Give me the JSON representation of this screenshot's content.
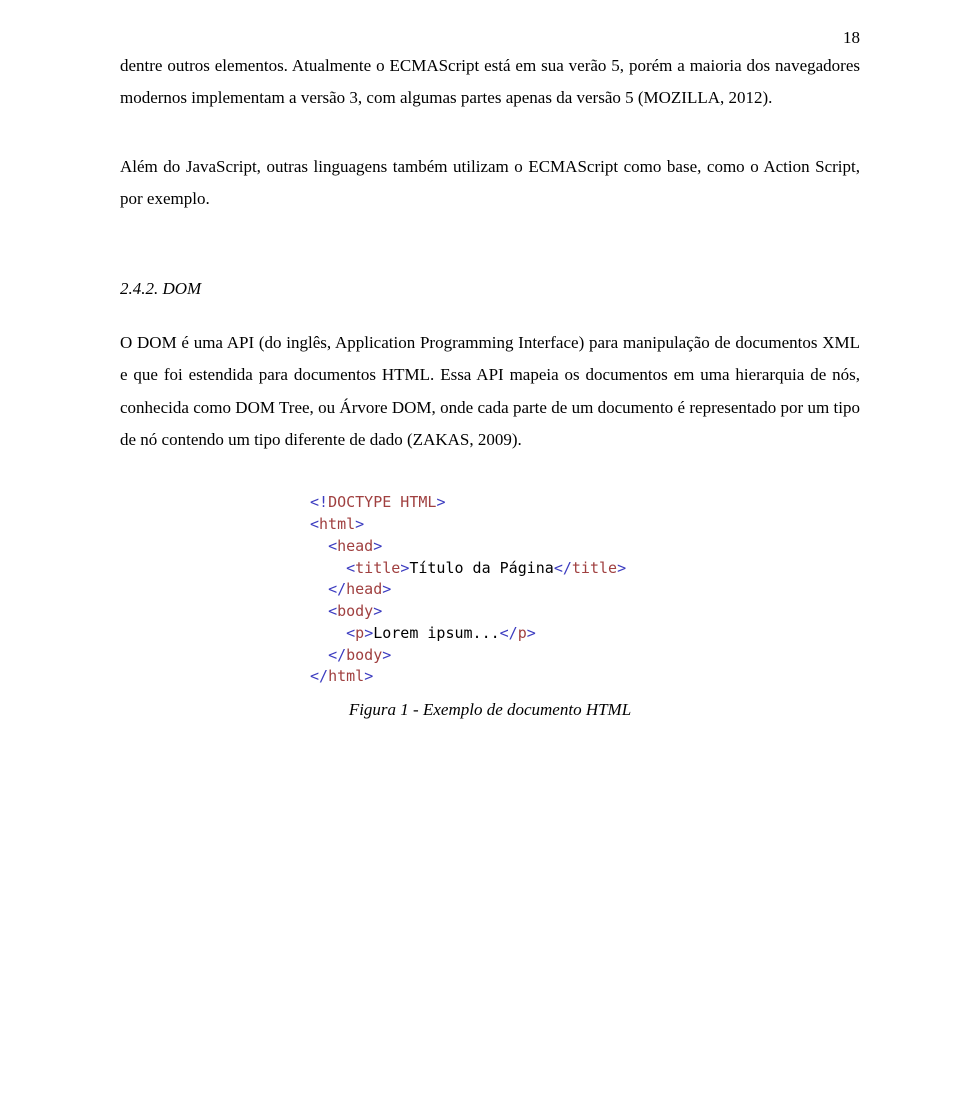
{
  "page_number": "18",
  "para1": "dentre outros elementos. Atualmente o ECMAScript está em sua verão 5, porém a maioria dos navegadores modernos implementam a versão 3, com algumas partes apenas da versão 5 (MOZILLA, 2012).",
  "para2": "Além do JavaScript, outras linguagens também utilizam o ECMAScript como base, como o Action Script, por exemplo.",
  "section": {
    "number": "2.4.2.",
    "title": "DOM"
  },
  "para3": "O DOM é uma API (do inglês, Application Programming Interface) para manipulação de documentos XML e que foi estendida para documentos HTML. Essa API mapeia os documentos em uma hierarquia de nós, conhecida como DOM Tree, ou Árvore DOM, onde cada parte de um documento é representado por um tipo de nó contendo um tipo diferente de dado (ZAKAS, 2009).",
  "code": {
    "l1a": "<!",
    "l1b": "DOCTYPE HTML",
    "l1c": ">",
    "l2a": "<",
    "l2b": "html",
    "l2c": ">",
    "l3a": "<",
    "l3b": "head",
    "l3c": ">",
    "l4a": "<",
    "l4b": "title",
    "l4c": ">",
    "l4t": "Título da Página",
    "l4d": "</",
    "l4e": "title",
    "l4f": ">",
    "l5a": "</",
    "l5b": "head",
    "l5c": ">",
    "l6a": "<",
    "l6b": "body",
    "l6c": ">",
    "l7a": "<",
    "l7b": "p",
    "l7c": ">",
    "l7t": "Lorem ipsum...",
    "l7d": "</",
    "l7e": "p",
    "l7f": ">",
    "l8a": "</",
    "l8b": "body",
    "l8c": ">",
    "l9a": "</",
    "l9b": "html",
    "l9c": ">"
  },
  "figure_caption": "Figura 1 - Exemplo de documento HTML"
}
